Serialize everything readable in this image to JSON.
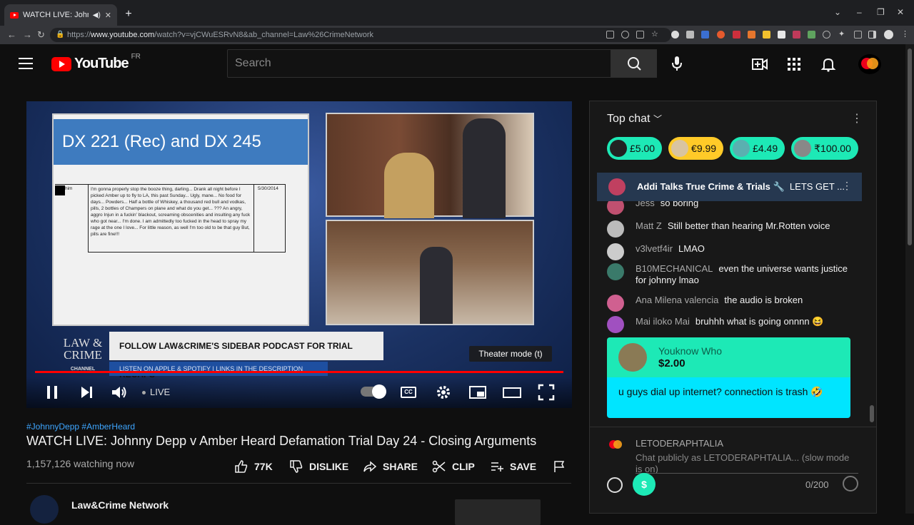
{
  "browser": {
    "tab_title": "WATCH LIVE: Johnny Depp v",
    "url_prefix": "https://",
    "url_host": "www.youtube.com",
    "url_path": "/watch?v=vjCWuESRvN8&ab_channel=Law%26CrimeNetwork"
  },
  "youtube": {
    "brand": "YouTube",
    "region": "FR",
    "search_placeholder": "Search"
  },
  "video": {
    "doc_title": "DX 221 (Rec) and DX 245",
    "doc_from": "him",
    "doc_date": "5/30/2014",
    "doc_body": "I'm gonna properly stop the booze thing, darling... Drank all night before I picked Amber up to fly to LA, this past Sunday... Ugly, mane... No food for days... Powders... Half a bottle of Whiskey, a thousand red bull and vodkas, pills, 2 bottles of Champers on plane and what do you get... ??? An angry, aggro Injun in a fuckin' blackout, screaming obscenities and insulting any fuck who got near... I'm done. I am admittedly too fucked in the head to spray my rage at the one I love... For little reason, as well     I'm too old to be that guy     But, pills are fine!!!",
    "lc_logo": "LAW & CRIME",
    "lc_channel": "CHANNEL",
    "banner_main": "FOLLOW LAW&CRIME'S SIDEBAR PODCAST FOR TRIAL RECAPS",
    "banner_sub": "LISTEN ON APPLE & SPOTIFY | LINKS IN THE DESCRIPTION",
    "tooltip": "Theater mode (t)",
    "live_label": "LIVE",
    "cc_label": "CC"
  },
  "meta": {
    "tags": "#JohnnyDepp #AmberHeard",
    "title": "WATCH LIVE: Johnny Depp v Amber Heard Defamation Trial Day 24 - Closing Arguments",
    "views": "1,157,126 watching now",
    "likes": "77K",
    "dislike": "DISLIKE",
    "share": "SHARE",
    "clip": "CLIP",
    "save": "SAVE",
    "channel_name": "Law&Crime Network"
  },
  "chat": {
    "header": "Top chat",
    "tickers": [
      {
        "amount": "£5.00",
        "color": "#1de9b6"
      },
      {
        "amount": "€9.99",
        "color": "#ffca28"
      },
      {
        "amount": "£4.49",
        "color": "#1de9b6"
      },
      {
        "amount": "₹100.00",
        "color": "#1de9b6"
      }
    ],
    "pinned": {
      "author": "Addi Talks True Crime & Trials 🔧",
      "text": "LETS GET ..."
    },
    "messages": [
      {
        "author": "Jess",
        "text": "so boring"
      },
      {
        "author": "Matt Z",
        "text": "Still better than hearing Mr.Rotten voice"
      },
      {
        "author": "v3lvetf4ir",
        "text": "LMAO"
      },
      {
        "author": "B10MECHANICAL",
        "text": "even the universe wants justice for johnny lmao"
      },
      {
        "author": "Ana Milena valencia",
        "text": "the audio is broken"
      },
      {
        "author": "Mai iloko Mai",
        "text": "bruhhh what is going onnnn 😆"
      }
    ],
    "superchat": {
      "author": "Youknow Who",
      "amount": "$2.00",
      "text": "u guys dial up internet? connection is trash 🤣"
    },
    "user_name": "LETODERAPHTALIA",
    "input_placeholder": "Chat publicly as LETODERAPHTALIA... (slow mode is on)",
    "char_count": "0/200"
  }
}
